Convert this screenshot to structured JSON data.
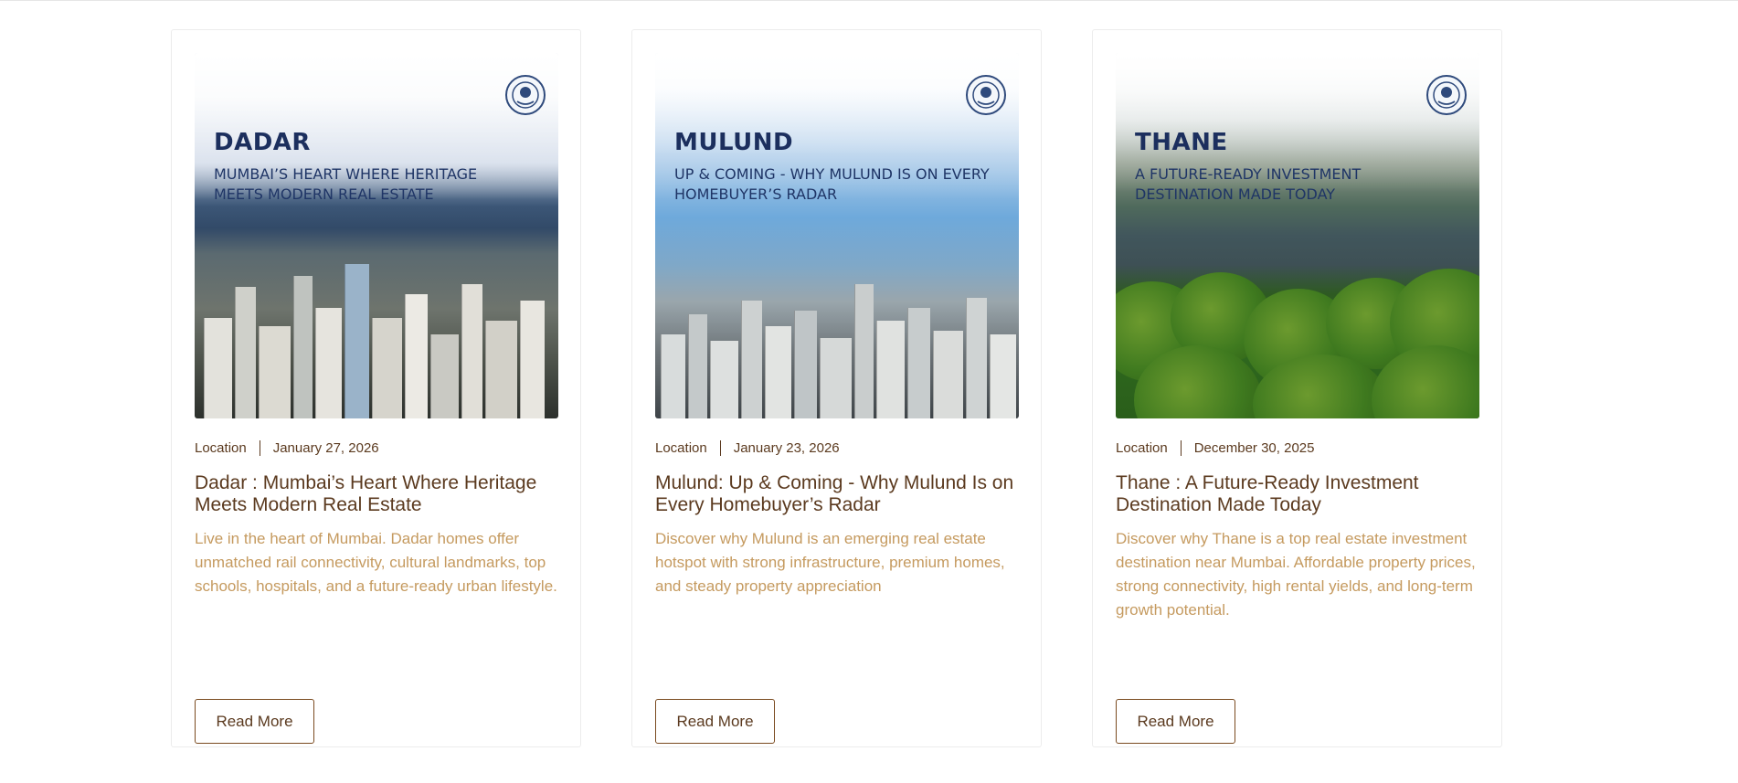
{
  "cards": [
    {
      "image_heading": "DADAR",
      "image_subheading": "MUMBAI’S HEART WHERE HERITAGE MEETS MODERN REAL ESTATE",
      "category": "Location",
      "date": "January 27, 2026",
      "title": "Dadar : Mumbai’s Heart Where Heritage Meets Modern Real Estate",
      "excerpt": "Live in the heart of Mumbai. Dadar homes offer unmatched rail connectivity, cultural landmarks, top schools, hospitals, and a future-ready urban lifestyle.",
      "button_label": "Read More"
    },
    {
      "image_heading": "MULUND",
      "image_subheading": "UP & COMING - WHY MULUND IS ON EVERY HOMEBUYER’S RADAR",
      "category": "Location",
      "date": "January 23, 2026",
      "title": "Mulund: Up & Coming - Why Mulund Is on Every Homebuyer’s Radar",
      "excerpt": "Discover why Mulund is an emerging real estate hotspot with strong infrastructure, premium homes, and steady property appreciation",
      "button_label": "Read More"
    },
    {
      "image_heading": "THANE",
      "image_subheading": "A FUTURE-READY INVESTMENT DESTINATION MADE TODAY",
      "category": "Location",
      "date": "December 30, 2025",
      "title": "Thane : A Future-Ready Investment Destination Made Today",
      "excerpt": "Discover why Thane is a top real estate investment destination near Mumbai. Affordable property prices, strong connectivity, high rental yields, and long-term growth potential.",
      "button_label": "Read More"
    }
  ],
  "colors": {
    "brand_navy": "#1c2f5e",
    "text_brown": "#5b3a1f",
    "excerpt_gold": "#c59a5f",
    "button_border": "#7a4a1f"
  },
  "icons": {
    "seal": "emblem-seal-icon"
  }
}
